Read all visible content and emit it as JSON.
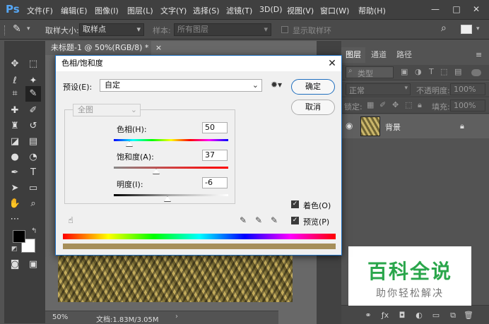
{
  "app": {
    "logo": "Ps",
    "menu": [
      "文件(F)",
      "编辑(E)",
      "图像(I)",
      "图层(L)",
      "文字(Y)",
      "选择(S)",
      "滤镜(T)",
      "3D(D)",
      "视图(V)",
      "窗口(W)",
      "帮助(H)"
    ],
    "window_controls": [
      "—",
      "□",
      "✕"
    ]
  },
  "options": {
    "sample_size_label": "取样大小:",
    "sample_size_value": "取样点",
    "sample_label": "样本:",
    "sample_value": "所有图层",
    "show_ring": "显示取样环"
  },
  "document": {
    "tab_title": "未标题-1 @ 50%(RGB/8) *",
    "tab_close": "×",
    "zoom": "50%",
    "doc_info": "文档:1.83M/3.05M"
  },
  "layers_panel": {
    "tabs": [
      "图层",
      "通道",
      "路径"
    ],
    "filter_kind": "类型",
    "blend_mode": "正常",
    "opacity_label": "不透明度:",
    "opacity_value": "100%",
    "lock_label": "锁定:",
    "fill_label": "填充:",
    "fill_value": "100%",
    "layer_name": "背景"
  },
  "dialog": {
    "title": "色相/饱和度",
    "preset_label": "预设(E):",
    "preset_value": "自定",
    "ok_button": "确定",
    "cancel_button": "取消",
    "channel_value": "全图",
    "hue_label": "色相(H):",
    "hue_value": "50",
    "saturation_label": "饱和度(A):",
    "saturation_value": "37",
    "lightness_label": "明度(I):",
    "lightness_value": "-6",
    "colorize_label": "着色(O)",
    "colorize_checked": true,
    "preview_label": "预览(P)",
    "preview_checked": true,
    "slider_levels": {
      "hue": 50,
      "saturation": 37,
      "lightness": -6
    },
    "result_color": "#a68f5a"
  },
  "watermark": {
    "main": "百科全说",
    "sub": "助你轻松解决"
  },
  "colors": {
    "accent": "#1f6fbf",
    "watermark_green": "#2aa64b"
  }
}
